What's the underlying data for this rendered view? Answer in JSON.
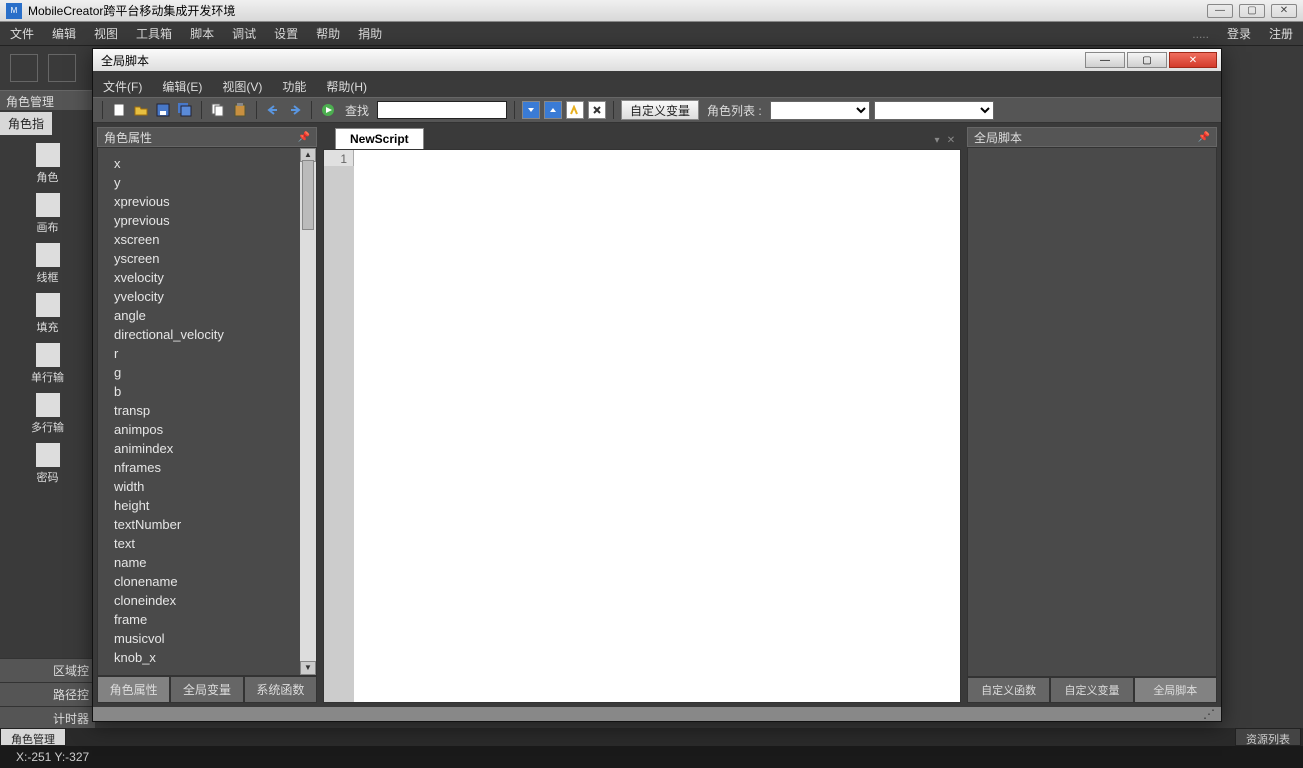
{
  "mainWindow": {
    "title": "MobileCreator跨平台移动集成开发环境",
    "menu": [
      "文件",
      "编辑",
      "视图",
      "工具箱",
      "脚本",
      "调试",
      "设置",
      "帮助",
      "捐助"
    ],
    "menuRight": [
      "登录",
      "注册"
    ],
    "dots": "....."
  },
  "leftDock": {
    "header": "角色管理",
    "activeTab": "角色指",
    "tools": [
      {
        "label": "角色"
      },
      {
        "label": "画布"
      },
      {
        "label": "线框"
      },
      {
        "label": "填充"
      },
      {
        "label": "单行输"
      },
      {
        "label": "多行输"
      },
      {
        "label": "密码"
      }
    ],
    "bottomTabs": [
      "区域控",
      "路径控",
      "计时器"
    ]
  },
  "bgBottomTabs": {
    "left": "角色管理",
    "right": "资源列表"
  },
  "status": {
    "coords": "X:-251  Y:-327"
  },
  "dialog": {
    "title": "全局脚本",
    "menu": [
      "文件(F)",
      "编辑(E)",
      "视图(V)",
      "功能",
      "帮助(H)"
    ],
    "toolbar": {
      "findLabel": "查找",
      "customVarBtn": "自定义变量",
      "roleListLabel": "角色列表 :"
    },
    "leftPane": {
      "header": "角色属性",
      "properties": [
        "x",
        "y",
        "xprevious",
        "yprevious",
        "xscreen",
        "yscreen",
        "xvelocity",
        "yvelocity",
        "angle",
        "directional_velocity",
        "r",
        "g",
        "b",
        "transp",
        "animpos",
        "animindex",
        "nframes",
        "width",
        "height",
        "textNumber",
        "text",
        "name",
        "clonename",
        "cloneindex",
        "frame",
        "musicvol",
        "knob_x"
      ],
      "tabs": [
        "角色属性",
        "全局变量",
        "系统函数"
      ]
    },
    "centerPane": {
      "tabName": "NewScript",
      "lineNumber": "1"
    },
    "rightPane": {
      "header": "全局脚本",
      "tabs": [
        "自定义函数",
        "自定义变量",
        "全局脚本"
      ]
    }
  }
}
